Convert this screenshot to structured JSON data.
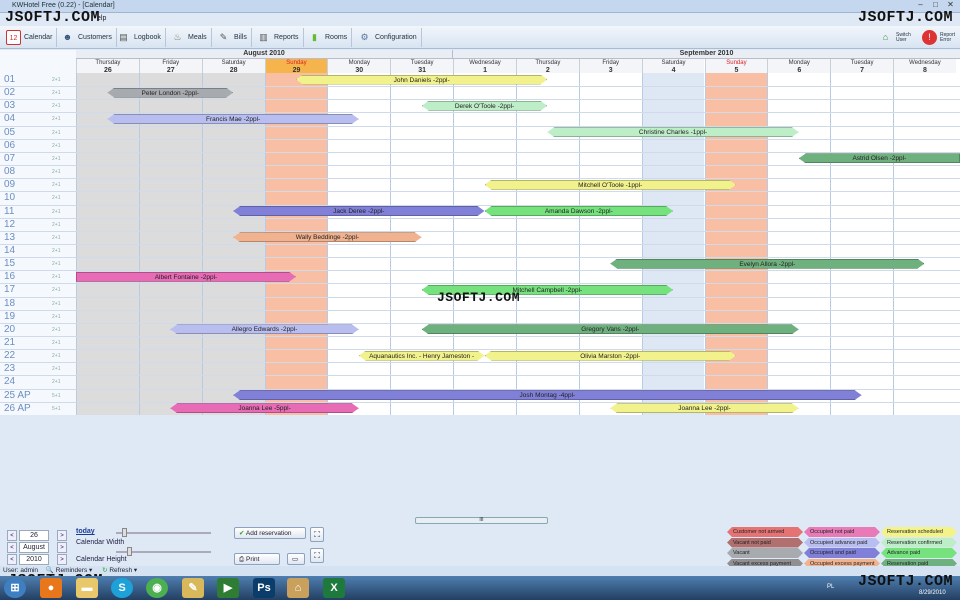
{
  "window": {
    "title": "KWHotel Free (0.22) - [Calendar]",
    "menu_partial": "elp"
  },
  "watermark": "JSOFTJ.COM",
  "toolbar": {
    "items": [
      "Calendar",
      "Customers",
      "Logbook",
      "Meals",
      "Bills",
      "Reports",
      "Rooms",
      "Configuration"
    ],
    "switch_user": "Switch User",
    "report_error": "Report Error"
  },
  "calendar": {
    "months": [
      "August 2010",
      "September 2010"
    ],
    "days": [
      {
        "dow": "Thursday",
        "d": "26"
      },
      {
        "dow": "Friday",
        "d": "27"
      },
      {
        "dow": "Saturday",
        "d": "28"
      },
      {
        "dow": "Sunday",
        "d": "29"
      },
      {
        "dow": "Monday",
        "d": "30"
      },
      {
        "dow": "Tuesday",
        "d": "31"
      },
      {
        "dow": "Wednesday",
        "d": "1"
      },
      {
        "dow": "Thursday",
        "d": "2"
      },
      {
        "dow": "Friday",
        "d": "3"
      },
      {
        "dow": "Saturday",
        "d": "4"
      },
      {
        "dow": "Sunday",
        "d": "5"
      },
      {
        "dow": "Monday",
        "d": "6"
      },
      {
        "dow": "Tuesday",
        "d": "7"
      },
      {
        "dow": "Wednesday",
        "d": "8"
      }
    ],
    "rooms": [
      {
        "n": "01",
        "cap": "2+1"
      },
      {
        "n": "02",
        "cap": "2+1"
      },
      {
        "n": "03",
        "cap": "2+1"
      },
      {
        "n": "04",
        "cap": "2+1"
      },
      {
        "n": "05",
        "cap": "2+1"
      },
      {
        "n": "06",
        "cap": "2+1"
      },
      {
        "n": "07",
        "cap": "2+1"
      },
      {
        "n": "08",
        "cap": "2+1"
      },
      {
        "n": "09",
        "cap": "2+1"
      },
      {
        "n": "10",
        "cap": "2+1"
      },
      {
        "n": "11",
        "cap": "2+1"
      },
      {
        "n": "12",
        "cap": "2+1"
      },
      {
        "n": "13",
        "cap": "2+1"
      },
      {
        "n": "14",
        "cap": "2+1"
      },
      {
        "n": "15",
        "cap": "2+1"
      },
      {
        "n": "16",
        "cap": "2+1"
      },
      {
        "n": "17",
        "cap": "2+1"
      },
      {
        "n": "18",
        "cap": "2+1"
      },
      {
        "n": "19",
        "cap": "2+1"
      },
      {
        "n": "20",
        "cap": "2+1"
      },
      {
        "n": "21",
        "cap": "2+1"
      },
      {
        "n": "22",
        "cap": "2+1"
      },
      {
        "n": "23",
        "cap": "2+1"
      },
      {
        "n": "24",
        "cap": "2+1"
      },
      {
        "n": "25 AP",
        "cap": "5+1"
      },
      {
        "n": "26 AP",
        "cap": "5+1"
      }
    ],
    "reservations": [
      {
        "row": 0,
        "from": 3.5,
        "to": 7.5,
        "label": "John Daniels -2ppl-",
        "color": "#f2f28c"
      },
      {
        "row": 1,
        "from": 0.5,
        "to": 2.5,
        "label": "Peter London -2ppl-",
        "color": "#a7aaae"
      },
      {
        "row": 2,
        "from": 5.5,
        "to": 7.5,
        "label": "Derek O'Toole -2ppl-",
        "color": "#bdeec8"
      },
      {
        "row": 3,
        "from": 0.5,
        "to": 4.5,
        "label": "Francis Mae -2ppl-",
        "color": "#b9bef0"
      },
      {
        "row": 4,
        "from": 7.5,
        "to": 11.5,
        "label": "Christine Charles -1ppl-",
        "color": "#bdeec8"
      },
      {
        "row": 6,
        "from": 11.5,
        "to": 14.6,
        "label": "Astrid Olsen -2ppl-",
        "color": "#6fb07f"
      },
      {
        "row": 8,
        "from": 6.5,
        "to": 10.5,
        "label": "Mitchell O'Toole -1ppl-",
        "color": "#f2f28c"
      },
      {
        "row": 10,
        "from": 2.5,
        "to": 6.5,
        "label": "Jack Deree -2ppl-",
        "color": "#8080d8"
      },
      {
        "row": 10,
        "from": 6.5,
        "to": 9.5,
        "label": "Amanda Dawson -2ppl-",
        "color": "#76e27e"
      },
      {
        "row": 12,
        "from": 2.5,
        "to": 5.5,
        "label": "Wally Beddinge -2ppl-",
        "color": "#f1b38f"
      },
      {
        "row": 14,
        "from": 8.5,
        "to": 13.5,
        "label": "Evelyn Allora -2ppl-",
        "color": "#6fb07f"
      },
      {
        "row": 15,
        "from": 0,
        "to": 3.5,
        "label": "Albert Fontaine -2ppl-",
        "color": "#e86bb5"
      },
      {
        "row": 16,
        "from": 5.5,
        "to": 9.5,
        "label": "Mitchell Campbell -2ppl-",
        "color": "#76e27e"
      },
      {
        "row": 19,
        "from": 1.5,
        "to": 4.5,
        "label": "Allegro Edwards -2ppl-",
        "color": "#b9bef0"
      },
      {
        "row": 19,
        "from": 5.5,
        "to": 11.5,
        "label": "Gregory Vans -2ppl-",
        "color": "#6fb07f"
      },
      {
        "row": 21,
        "from": 4.5,
        "to": 6.5,
        "label": "Aquanautics Inc. - Henry Jameston -",
        "color": "#f2f28c"
      },
      {
        "row": 21,
        "from": 6.5,
        "to": 10.5,
        "label": "Olivia Marston -2ppl-",
        "color": "#f2f28c"
      },
      {
        "row": 24,
        "from": 2.5,
        "to": 12.5,
        "label": "Josh Montag -4ppl-",
        "color": "#8080d8"
      },
      {
        "row": 25,
        "from": 1.5,
        "to": 4.5,
        "label": "Joanna Lee -5ppl-",
        "color": "#e86bb5"
      },
      {
        "row": 25,
        "from": 8.5,
        "to": 11.5,
        "label": "Joanna Lee -2ppl-",
        "color": "#f2f28c"
      }
    ]
  },
  "controls": {
    "day": "26",
    "month": "August",
    "year": "2010",
    "today": "today",
    "width_label": "Calendar Width",
    "height_label": "Calendar Height",
    "add_label": "Add reservation",
    "print_label": "Print",
    "scroll_grip": "III"
  },
  "legend": [
    {
      "label": "Customer not arrived",
      "color": "#e57373"
    },
    {
      "label": "Occupied not paid",
      "color": "#e87ab8"
    },
    {
      "label": "Reservation scheduled",
      "color": "#f3f38a"
    },
    {
      "label": "Vacant not paid",
      "color": "#b07070"
    },
    {
      "label": "Occupied advance paid",
      "color": "#b9bef0"
    },
    {
      "label": "Reservation confirmed",
      "color": "#bdeec8"
    },
    {
      "label": "Vacant",
      "color": "#a7aaae"
    },
    {
      "label": "Occupied and paid",
      "color": "#8080d8"
    },
    {
      "label": "Advance paid",
      "color": "#76e27e"
    },
    {
      "label": "Vacant excess payment",
      "color": "#909090"
    },
    {
      "label": "Occupied excess payment",
      "color": "#f1b38f"
    },
    {
      "label": "Reservation paid",
      "color": "#6fb07f"
    }
  ],
  "status": {
    "user": "User: admin",
    "reminders": "Reminders",
    "refresh": "Refresh"
  },
  "taskbar": {
    "lang": "PL",
    "date": "8/29/2010"
  }
}
